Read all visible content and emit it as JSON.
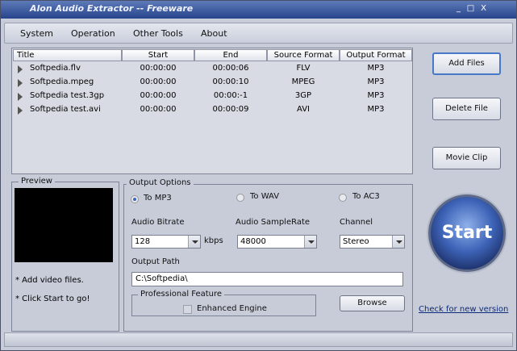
{
  "window": {
    "title": "Alon Audio Extractor -- Freeware",
    "controls": [
      "_",
      "□",
      "X"
    ]
  },
  "menu": [
    "System",
    "Operation",
    "Other Tools",
    "About"
  ],
  "file_list": {
    "columns": [
      "Title",
      "Start",
      "End",
      "Source Format",
      "Output Format"
    ],
    "rows": [
      [
        "Softpedia.flv",
        "00:00:00",
        "00:00:06",
        "FLV",
        "MP3"
      ],
      [
        "Softpedia.mpeg",
        "00:00:00",
        "00:00:10",
        "MPEG",
        "MP3"
      ],
      [
        "Softpedia test.3gp",
        "00:00:00",
        "00:00:-1",
        "3GP",
        "MP3"
      ],
      [
        "Softpedia test.avi",
        "00:00:00",
        "00:00:09",
        "AVI",
        "MP3"
      ]
    ]
  },
  "buttons": {
    "add_files": "Add Files",
    "delete_file": "Delete File",
    "movie_clip": "Movie Clip",
    "browse": "Browse",
    "start": "Start"
  },
  "preview": {
    "label": "Preview",
    "notes": [
      "* Add video files.",
      "* Click Start to go!"
    ]
  },
  "output_options": {
    "label": "Output Options",
    "formats": [
      {
        "label": "To MP3",
        "selected": true
      },
      {
        "label": "To WAV",
        "selected": false
      },
      {
        "label": "To AC3",
        "selected": false
      }
    ],
    "bitrate_label": "Audio Bitrate",
    "bitrate_value": "128",
    "bitrate_unit": "kbps",
    "samplerate_label": "Audio SampleRate",
    "samplerate_value": "48000",
    "channel_label": "Channel",
    "channel_value": "Stereo",
    "path_label": "Output Path",
    "path_value": "C:\\Softpedia\\",
    "professional_label": "Professional Feature",
    "enhanced_label": "Enhanced Engine",
    "enhanced_checked": false
  },
  "link_check_version": "Check for new version",
  "colors": {
    "title_bar": "#27448c",
    "selected_radio": "#3b66c4",
    "panel": "#c7ccd8"
  }
}
